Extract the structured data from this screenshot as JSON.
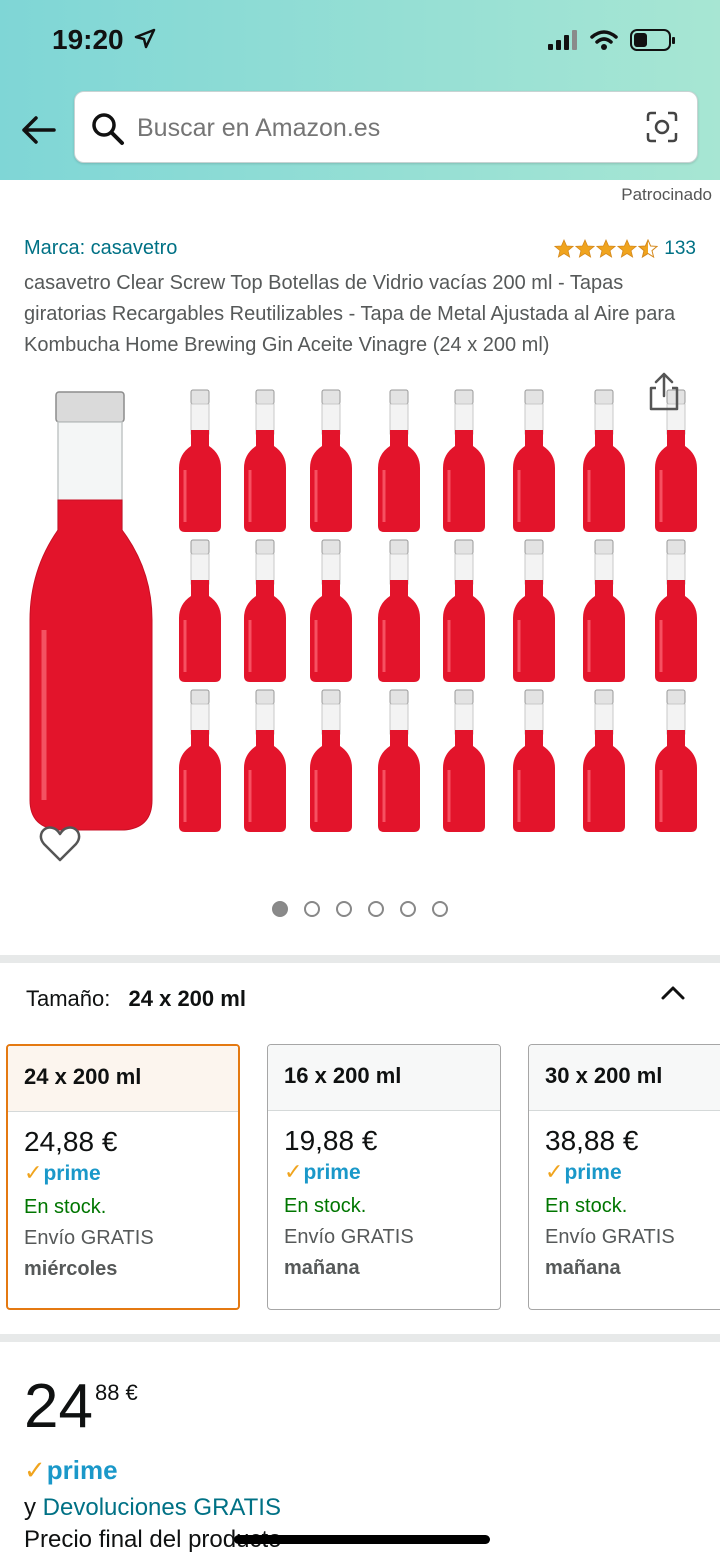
{
  "status_bar": {
    "time": "19:20"
  },
  "search": {
    "placeholder": "Buscar en Amazon.es"
  },
  "sponsored_label": "Patrocinado",
  "product": {
    "brand": "Marca: casavetro",
    "rating_count": "133",
    "rating_stars": 4.5,
    "title": "casavetro Clear Screw Top Botellas de Vidrio vacías 200 ml - Tapas giratorias Recargables Reutilizables - Tapa de Metal Ajustada al Aire para Kombucha Home Brewing Gin Aceite Vinagre (24 x 200 ml)"
  },
  "gallery": {
    "total_images": 6,
    "active_index": 0
  },
  "size": {
    "label": "Tamaño:",
    "value": "24 x 200 ml"
  },
  "variants": [
    {
      "name": "24 x 200 ml",
      "price": "24,88 €",
      "prime": "prime",
      "stock": "En stock.",
      "shipping": "Envío GRATIS",
      "day": "miércoles",
      "selected": true
    },
    {
      "name": "16 x 200 ml",
      "price": "19,88 €",
      "prime": "prime",
      "stock": "En stock.",
      "shipping": "Envío GRATIS",
      "day": "mañana",
      "selected": false
    },
    {
      "name": "30 x 200 ml",
      "price": "38,88 €",
      "prime": "prime",
      "stock": "En stock.",
      "shipping": "Envío GRATIS",
      "day": "mañana",
      "selected": false
    }
  ],
  "price": {
    "whole": "24",
    "fraction": "88 €"
  },
  "prime_label": "prime",
  "returns": {
    "prefix": "y",
    "link": "Devoluciones GRATIS"
  },
  "final_price_note": "Precio final del producto",
  "colors": {
    "accent_teal": "#007185",
    "prime_blue": "#1a98c9",
    "stock_green": "#007600",
    "selected_border": "#e47911",
    "star_orange": "#f0a41e"
  }
}
